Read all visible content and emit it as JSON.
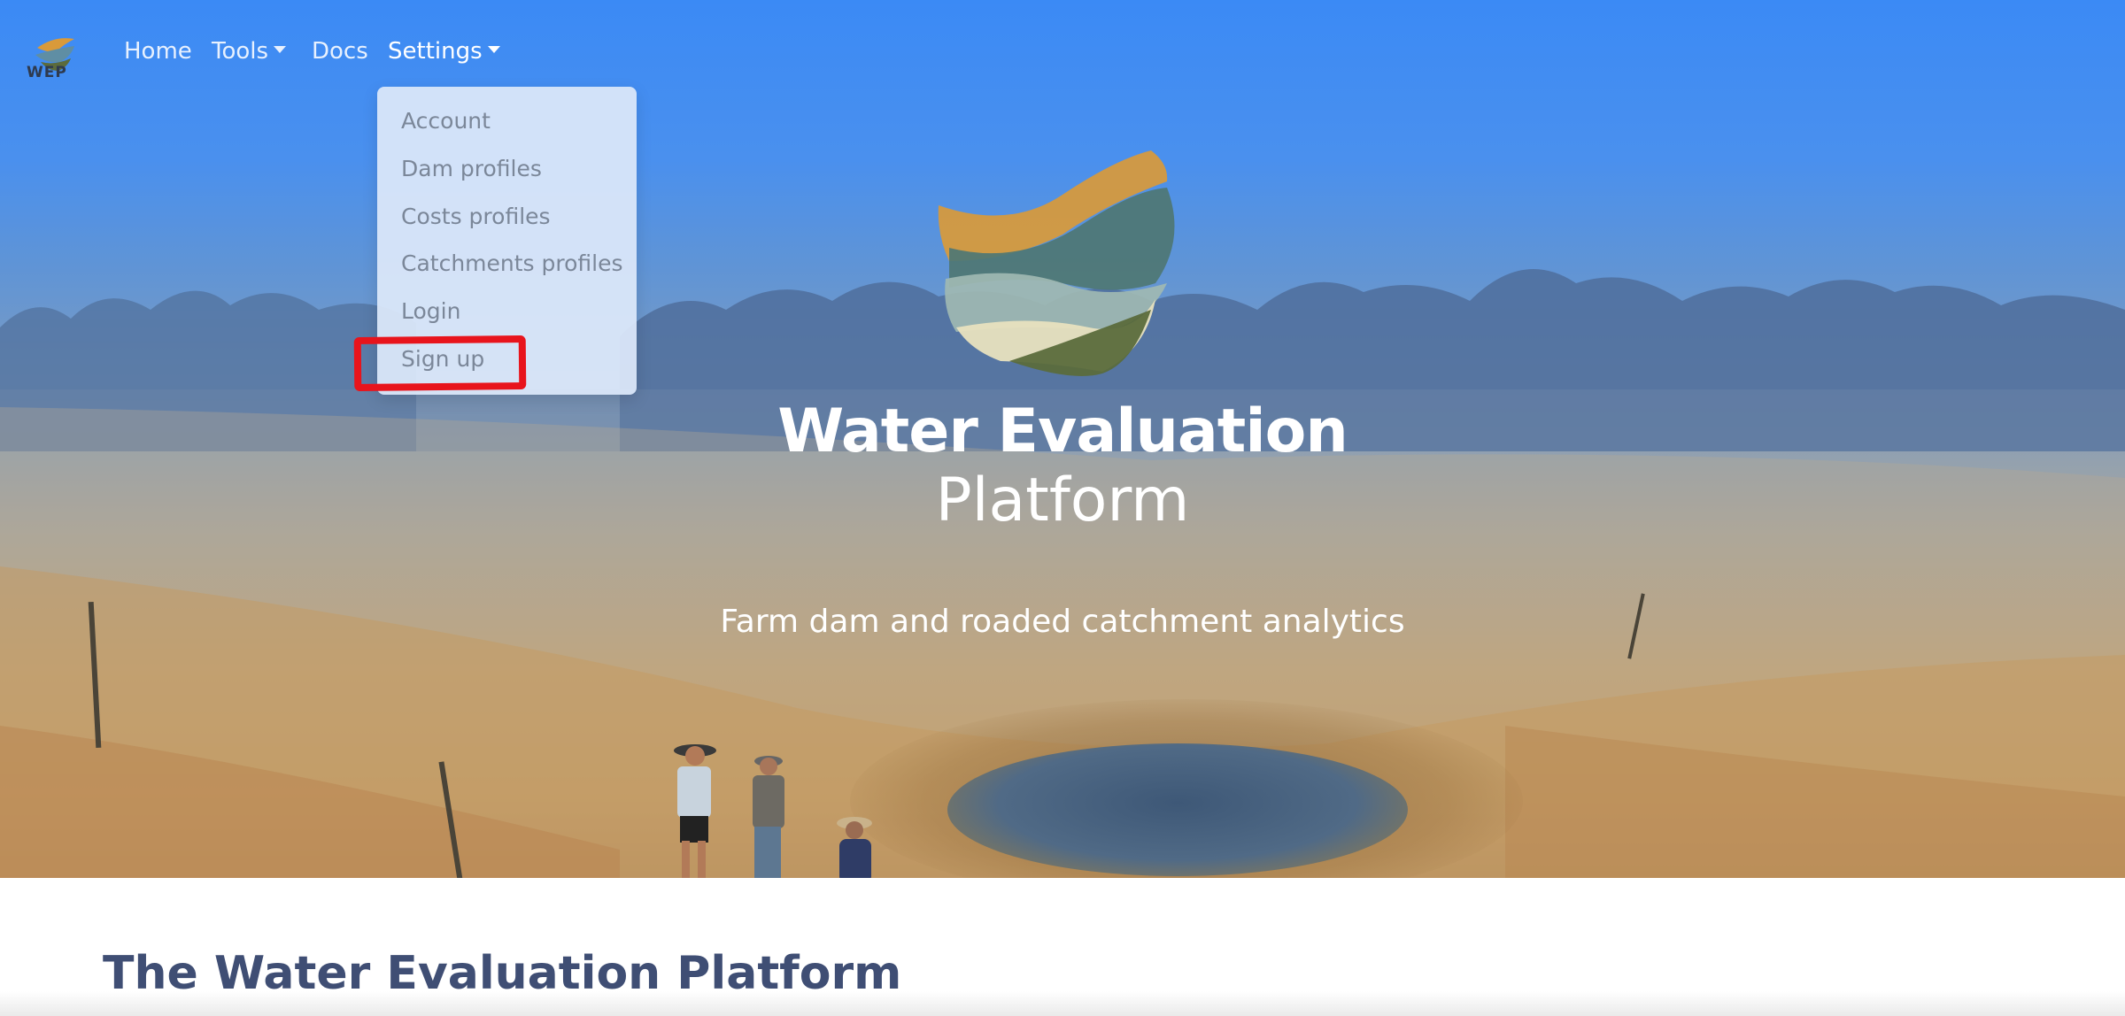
{
  "nav": {
    "brand_text": "WEP",
    "items": [
      {
        "label": "Home"
      },
      {
        "label": "Tools"
      },
      {
        "label": "Docs"
      },
      {
        "label": "Settings"
      }
    ]
  },
  "settings_menu": {
    "items": [
      {
        "label": "Account"
      },
      {
        "label": "Dam profiles"
      },
      {
        "label": "Costs profiles"
      },
      {
        "label": "Catchments profiles"
      },
      {
        "label": "Login"
      },
      {
        "label": "Sign up"
      }
    ],
    "highlighted_item": "Sign up",
    "highlight_color": "#e8141c"
  },
  "hero": {
    "title_line1": "Water Evaluation",
    "title_line2": "Platform",
    "tagline": "Farm dam and roaded catchment analytics"
  },
  "content": {
    "heading": "The Water Evaluation Platform"
  },
  "colors": {
    "sky": "#3b8af5",
    "logo_orange": "#d99a3a",
    "logo_teal": "#4f7774",
    "logo_olive": "#5b6b3c",
    "logo_sage": "#9fb9b2",
    "logo_cream": "#e8e1bf",
    "heading": "#3f4e74",
    "menu_bg": "#dde8fa",
    "menu_text": "#7b8799"
  },
  "icons": {
    "brand": "wep-logo-icon",
    "hero_logo": "water-evaluation-logo-icon",
    "dropdown_caret": "caret-down-icon"
  }
}
